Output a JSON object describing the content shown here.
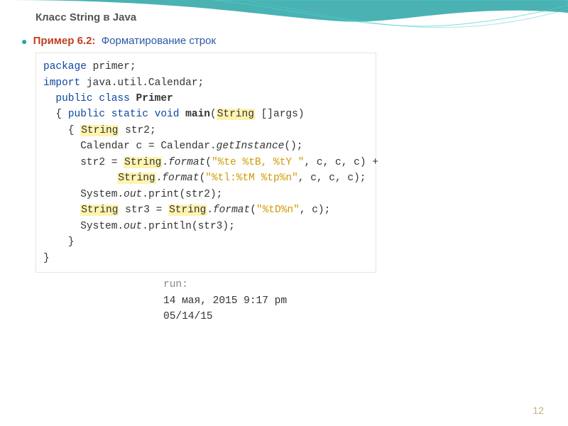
{
  "slide": {
    "title": "Класс String в Java",
    "example_label": "Пример 6.2:",
    "example_desc": "Форматирование строк",
    "page_number": "12"
  },
  "code": {
    "l1_kw1": "package",
    "l1_rest": " primer;",
    "l2_kw1": "import",
    "l2_rest": " java.util.Calendar;",
    "l3_pad": "  ",
    "l3_kw1": "public",
    "l3_kw2": "class",
    "l3_cls": "Primer",
    "l4_pad": "  { ",
    "l4_kw1": "public",
    "l4_kw2": "static",
    "l4_kw3": "void",
    "l4_mth": "main",
    "l4_p1": "(",
    "l4_type": "String",
    "l4_p2": " []args)",
    "l5_pad": "    { ",
    "l5_type": "String",
    "l5_rest": " str2;",
    "l6_pad": "      ",
    "l6_txt": "Calendar c = Calendar.",
    "l6_mth": "getInstance",
    "l6_end": "();",
    "l7_pad": "      ",
    "l7_txt": "str2 = ",
    "l7_cls": "String",
    "l7_dot": ".",
    "l7_mth": "format",
    "l7_p1": "(",
    "l7_str": "\"%te %tB, %tY \"",
    "l7_end": ", c, c, c) +",
    "l8_pad": "            ",
    "l8_cls": "String",
    "l8_dot": ".",
    "l8_mth": "format",
    "l8_p1": "(",
    "l8_str": "\"%tl:%tM %tp%n\"",
    "l8_end": ", c, c, c);",
    "l9_pad": "      ",
    "l9_txt": "System.",
    "l9_out": "out",
    "l9_rest": ".print(str2);",
    "l10_pad": "      ",
    "l10_type": "String",
    "l10_mid": " str3 = ",
    "l10_cls": "String",
    "l10_dot": ".",
    "l10_mth": "format",
    "l10_p1": "(",
    "l10_str": "\"%tD%n\"",
    "l10_end": ", c);",
    "l11_pad": "      ",
    "l11_txt": "System.",
    "l11_out": "out",
    "l11_rest": ".println(str3);",
    "l12_pad": "    }",
    "l13_pad": "}"
  },
  "output": {
    "run_label": "run:",
    "line1": "14 мая, 2015 9:17 pm",
    "line2": "05/14/15"
  }
}
